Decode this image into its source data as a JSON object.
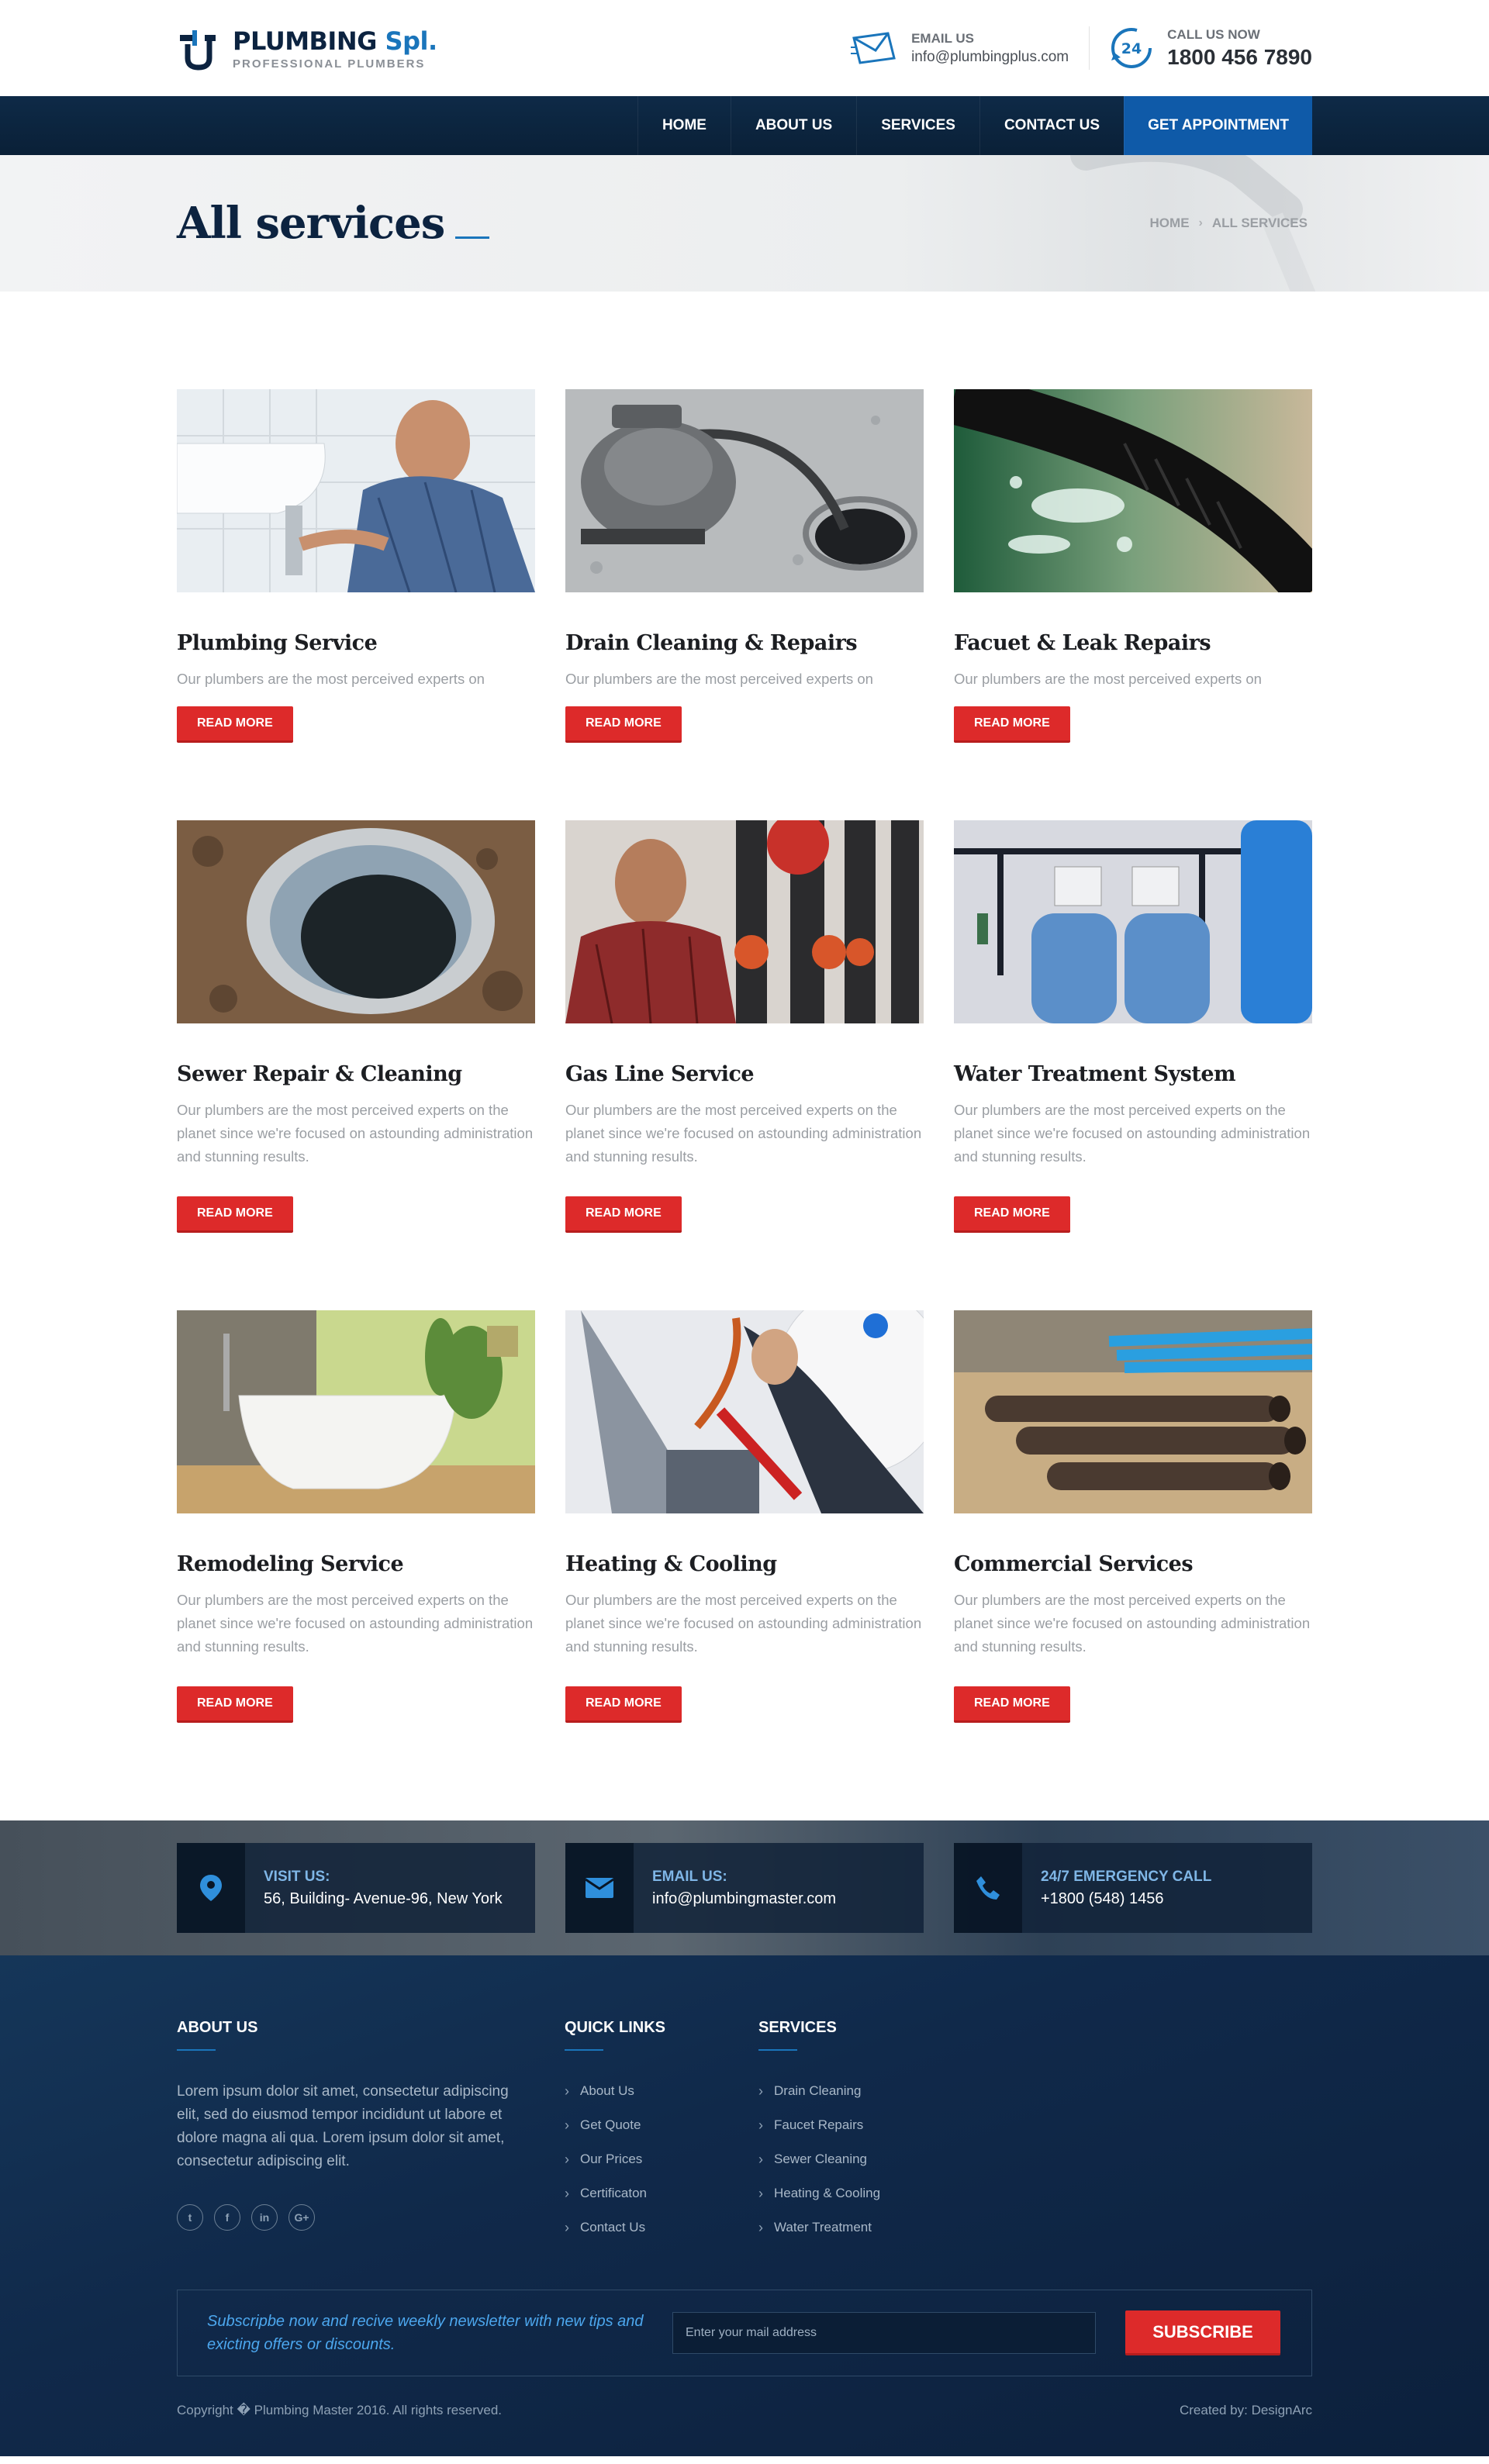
{
  "brand": {
    "name": "PLUMBING",
    "name_suffix": "Spl.",
    "tagline": "PROFESSIONAL PLUMBERS",
    "accent": "#1a75bb",
    "navy": "#0c2340",
    "red": "#dd2a2a"
  },
  "header": {
    "email_label": "EMAIL US",
    "email_value": "info@plumbingplus.com",
    "call_label": "CALL US NOW",
    "call_value": "1800 456 7890",
    "call_badge": "24"
  },
  "nav": {
    "items": [
      "HOME",
      "ABOUT US",
      "SERVICES",
      "CONTACT US"
    ],
    "cta": "GET APPOINTMENT"
  },
  "page": {
    "title": "All services",
    "breadcrumb": [
      "HOME",
      "ALL SERVICES"
    ],
    "breadcrumb_sep": "›"
  },
  "services": [
    {
      "title": "Plumbing Service",
      "text": "Our plumbers are the most perceived experts on",
      "button": "READ MORE",
      "image": "plumber-sink-image"
    },
    {
      "title": "Drain Cleaning & Repairs",
      "text": "Our plumbers are the most perceived experts on",
      "button": "READ MORE",
      "image": "drain-machine-image"
    },
    {
      "title": "Facuet & Leak Repairs",
      "text": "Our plumbers are the most perceived experts on",
      "button": "READ MORE",
      "image": "leaking-hose-image"
    },
    {
      "title": "Sewer Repair & Cleaning",
      "text": "Our plumbers are the most perceived experts on the planet since we're focused on astounding administration and stunning results.",
      "button": "READ MORE",
      "image": "sewer-pit-image"
    },
    {
      "title": "Gas Line Service",
      "text": "Our plumbers are the most perceived experts on the planet since we're focused on astounding administration and stunning results.",
      "button": "READ MORE",
      "image": "gas-pipes-image"
    },
    {
      "title": "Water Treatment System",
      "text": "Our plumbers are the most perceived experts on the planet since we're focused on astounding administration and stunning results.",
      "button": "READ MORE",
      "image": "water-tanks-image"
    },
    {
      "title": "Remodeling Service",
      "text": "Our plumbers are the most perceived experts on the planet since we're focused on astounding administration and stunning results.",
      "button": "READ MORE",
      "image": "bathtub-image"
    },
    {
      "title": "Heating & Cooling",
      "text": "Our plumbers are the most perceived experts on the planet since we're focused on astounding administration and stunning results.",
      "button": "READ MORE",
      "image": "heater-wrench-image"
    },
    {
      "title": "Commercial Services",
      "text": "Our plumbers are the most perceived experts on the planet since we're focused on astounding administration and stunning results.",
      "button": "READ MORE",
      "image": "pipes-yard-image"
    }
  ],
  "info": [
    {
      "label": "VISIT US:",
      "value": "56, Building- Avenue-96, New York",
      "icon": "map-pin-icon"
    },
    {
      "label": "EMAIL US:",
      "value": "info@plumbingmaster.com",
      "icon": "envelope-icon"
    },
    {
      "label": "24/7 EMERGENCY CALL",
      "value": "+1800 (548) 1456",
      "icon": "phone-icon"
    }
  ],
  "footer": {
    "about_title": "ABOUT US",
    "about_text": "Lorem ipsum dolor sit amet, consectetur adipiscing elit, sed do eiusmod tempor incididunt ut labore et dolore magna ali qua. Lorem ipsum dolor sit amet, consectetur adipiscing elit.",
    "socials": [
      "twitter-icon",
      "facebook-icon",
      "linkedin-icon",
      "google-plus-icon"
    ],
    "social_glyphs": [
      "t",
      "f",
      "in",
      "G+"
    ],
    "links_title": "QUICK LINKS",
    "links": [
      "About Us",
      "Get Quote",
      "Our Prices",
      "Certificaton",
      "Contact Us"
    ],
    "services_title": "SERVICES",
    "services": [
      "Drain Cleaning",
      "Faucet Repairs",
      "Sewer Cleaning",
      "Heating & Cooling",
      "Water Treatment"
    ],
    "newsletter_text": "Subscripbe now and recive weekly newsletter with new tips and exicting offers or discounts.",
    "newsletter_placeholder": "Enter your mail address",
    "subscribe": "SUBSCRIBE",
    "copyright": "Copyright � Plumbing Master 2016. All rights reserved.",
    "credit": "Created by: DesignArc"
  }
}
